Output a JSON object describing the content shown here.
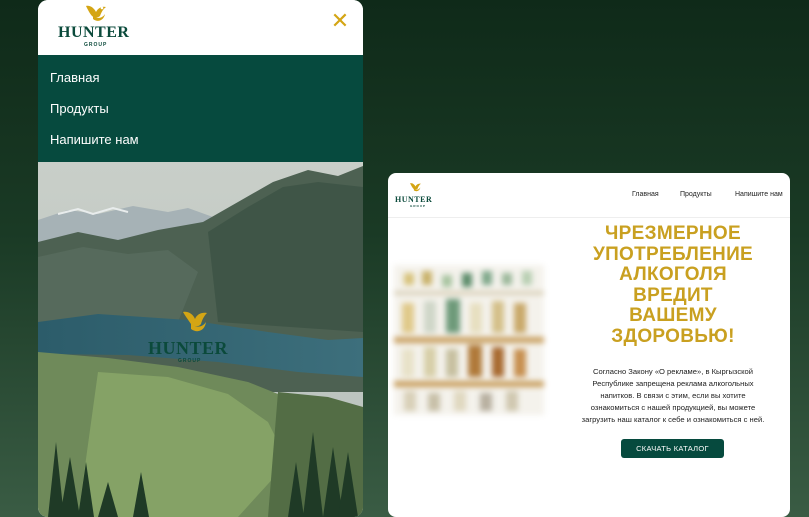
{
  "brand": {
    "name": "HUNTER",
    "sub": "GROUP",
    "logo_icon": "hunter-bird-logo",
    "accent_color": "#d4a514",
    "primary_color": "#064a3e"
  },
  "mobile": {
    "close_icon": "close-icon",
    "nav": [
      {
        "label": "Главная"
      },
      {
        "label": "Продукты"
      },
      {
        "label": "Напишите нам"
      }
    ]
  },
  "desktop": {
    "nav": [
      {
        "label": "Главная"
      },
      {
        "label": "Продукты"
      },
      {
        "label": "Напишите нам"
      }
    ],
    "warning": [
      "ЧРЕЗМЕРНОЕ",
      "УПОТРЕБЛЕНИЕ",
      "АЛКОГОЛЯ",
      "ВРЕДИТ",
      "ВАШЕМУ",
      "ЗДОРОВЬЮ!"
    ],
    "body": [
      "Согласно Закону «О рекламе», в Кыргызской",
      "Республике запрещена реклама алкогольных",
      "напитков. В связи с этим, если вы хотите",
      "ознакомиться с нашей продукцией, вы можете",
      "загрузить наш каталог к себе и ознакомиться с ней."
    ],
    "cta": "СКАЧАТЬ КАТАЛОГ"
  }
}
